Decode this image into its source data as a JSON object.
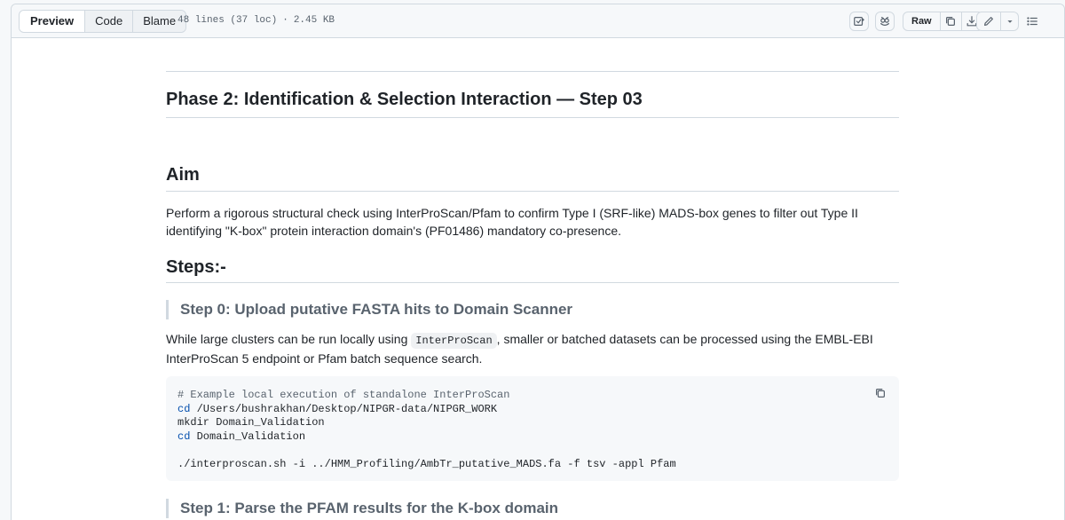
{
  "toolbar": {
    "tabs": [
      {
        "label": "Preview",
        "active": true
      },
      {
        "label": "Code",
        "active": false
      },
      {
        "label": "Blame",
        "active": false
      }
    ],
    "lines_info": "48 lines (37 loc)",
    "separator": "·",
    "size_info": "2.45 KB",
    "raw_label": "Raw",
    "icons": [
      "copilot-icon",
      "code-review-icon",
      "copy-icon",
      "download-icon",
      "pencil-icon",
      "dropdown-caret-icon",
      "list-icon"
    ]
  },
  "document": {
    "title": "Phase 2: Identification & Selection Interaction — Step 03",
    "aim_heading": "Aim",
    "aim_text": "Perform a rigorous structural check using InterProScan/Pfam to confirm Type I (SRF-like) MADS-box genes to filter out Type II identifying \"K-box\" protein interaction domain's (PF01486) mandatory co-presence.",
    "steps_heading": "Steps:-",
    "step0": {
      "heading": "Step 0: Upload putative FASTA hits to Domain Scanner",
      "text_before": "While large clusters can be run locally using ",
      "code_inline": "InterProScan",
      "text_after": ", smaller or batched datasets can be processed using the EMBL-EBI InterProScan 5 endpoint or Pfam batch sequence search.",
      "code_lines": [
        {
          "text": "# Example local execution of standalone InterProScan",
          "kind": "comment"
        },
        {
          "kw": "cd",
          "text": " /Users/bushrakhan/Desktop/NIPGR-data/NIPGR_WORK",
          "kind": "cmd"
        },
        {
          "text": "mkdir Domain_Validation",
          "kind": "plain"
        },
        {
          "kw": "cd",
          "text": " Domain_Validation",
          "kind": "cmd"
        },
        {
          "text": "",
          "kind": "plain"
        },
        {
          "text": "./interproscan.sh -i ../HMM_Profiling/AmbTr_putative_MADS.fa -f tsv -appl Pfam",
          "kind": "plain"
        }
      ]
    },
    "step1": {
      "heading": "Step 1: Parse the PFAM results for the K-box domain"
    }
  }
}
